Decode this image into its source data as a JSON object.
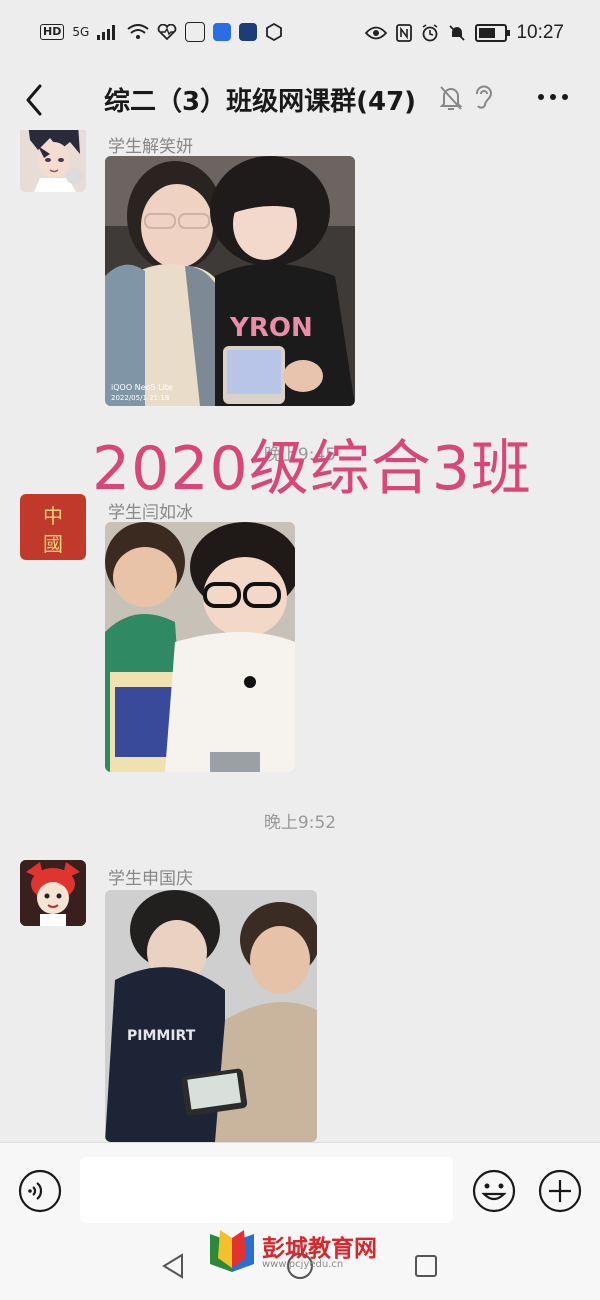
{
  "status_bar": {
    "hd": "HD",
    "signal": "5G",
    "time": "10:27"
  },
  "header": {
    "title": "综二（3）班级网课群(47)"
  },
  "messages": [
    {
      "sender": "学生解笑妍",
      "avatar_icon": "anime-boy-avatar"
    },
    {
      "sender": "学生闫如冰",
      "avatar_icon": "china-seal-avatar",
      "avatar_text": [
        "中",
        "國"
      ]
    },
    {
      "sender": "学生申国庆",
      "avatar_icon": "cartoon-girl-avatar"
    }
  ],
  "timestamps": [
    "晚上9:45",
    "晚上9:52"
  ],
  "photo1_caption": "iQOO Neo5 Lite",
  "watermark": "2020级综合3班",
  "input": {
    "placeholder": ""
  },
  "logo": {
    "text": "彭城教育网",
    "url": "www.pcjyedu.cn"
  },
  "colors": {
    "background": "#ededed",
    "watermark": "#d8467a",
    "logo": "#d4282d"
  }
}
